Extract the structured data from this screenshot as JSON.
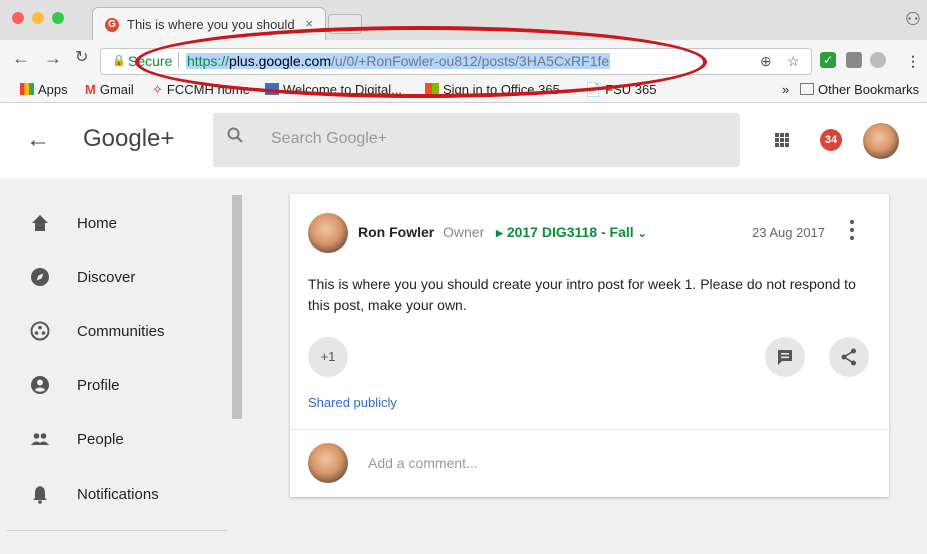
{
  "browser": {
    "tab_title": "This is where you you should c",
    "tab_close": "×",
    "secure_label": "Secure",
    "url_scheme": "https://",
    "url_host": "plus.google.com",
    "url_path": "/u/0/+RonFowler-ou812/posts/3HA5CxRF1fe",
    "bookmarks": {
      "apps": "Apps",
      "gmail": "Gmail",
      "fccmh": "FCCMH home",
      "digital": "Welcome to Digital...",
      "office": "Sign in to Office 365",
      "fsu": "FSU 365",
      "overflow": "»",
      "other": "Other Bookmarks"
    },
    "colors": {
      "secure_green": "#0a8d39",
      "annotation_red": "#c8171d"
    }
  },
  "gplus": {
    "logo": "Google+",
    "search_placeholder": "Search Google+",
    "notification_count": "34",
    "accent_red": "#db4437"
  },
  "sidebar": {
    "items": [
      {
        "label": "Home",
        "icon": "home-icon"
      },
      {
        "label": "Discover",
        "icon": "compass-icon"
      },
      {
        "label": "Communities",
        "icon": "communities-icon"
      },
      {
        "label": "Profile",
        "icon": "profile-icon"
      },
      {
        "label": "People",
        "icon": "people-icon"
      },
      {
        "label": "Notifications",
        "icon": "bell-icon"
      }
    ]
  },
  "post": {
    "author": "Ron Fowler",
    "role": "Owner",
    "community": "2017 DIG3118 - Fall",
    "date": "23 Aug 2017",
    "body": "This is where you you should create your intro post for week 1. Please do not respond to this post, make your own.",
    "plus_one": "+1",
    "visibility": "Shared publicly",
    "comment_placeholder": "Add a comment..."
  }
}
